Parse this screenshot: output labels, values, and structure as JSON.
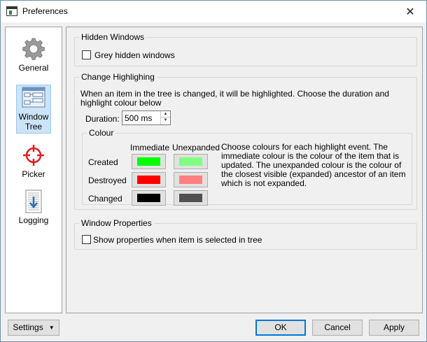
{
  "window": {
    "title": "Preferences",
    "close_glyph": "✕"
  },
  "sidebar": {
    "items": [
      {
        "label": "General",
        "icon": "gear-icon"
      },
      {
        "label": "Window Tree",
        "line1": "Window",
        "line2": "Tree",
        "icon": "window-tree-icon",
        "selected": true
      },
      {
        "label": "Picker",
        "icon": "crosshair-icon"
      },
      {
        "label": "Logging",
        "icon": "log-document-icon"
      }
    ]
  },
  "hidden_windows": {
    "title": "Hidden Windows",
    "grey_label": "Grey hidden windows",
    "grey_checked": false
  },
  "change_highlighting": {
    "title": "Change Highlighing",
    "description": "When an item in the tree is changed, it will be highlighted. Choose the duration and highlight colour below",
    "duration_label": "Duration:",
    "duration_value": "500 ms",
    "colour": {
      "title": "Colour",
      "col_immediate": "Immediate",
      "col_unexpanded": "Unexpanded",
      "rows": [
        {
          "label": "Created",
          "immediate": "#00ff00",
          "unexpanded": "#80ff80"
        },
        {
          "label": "Destroyed",
          "immediate": "#ff0000",
          "unexpanded": "#ff8080"
        },
        {
          "label": "Changed",
          "immediate": "#000000",
          "unexpanded": "#505050"
        }
      ],
      "help": "Choose colours for each highlight event. The immediate colour is the colour of the item that is updated. The unexpanded colour is the colour of the closest visible (expanded) ancestor of an item which is not expanded."
    }
  },
  "window_properties": {
    "title": "Window Properties",
    "show_label": "Show properties when item is selected in tree",
    "show_checked": false
  },
  "footer": {
    "settings_label": "Settings",
    "ok_label": "OK",
    "cancel_label": "Cancel",
    "apply_label": "Apply"
  }
}
